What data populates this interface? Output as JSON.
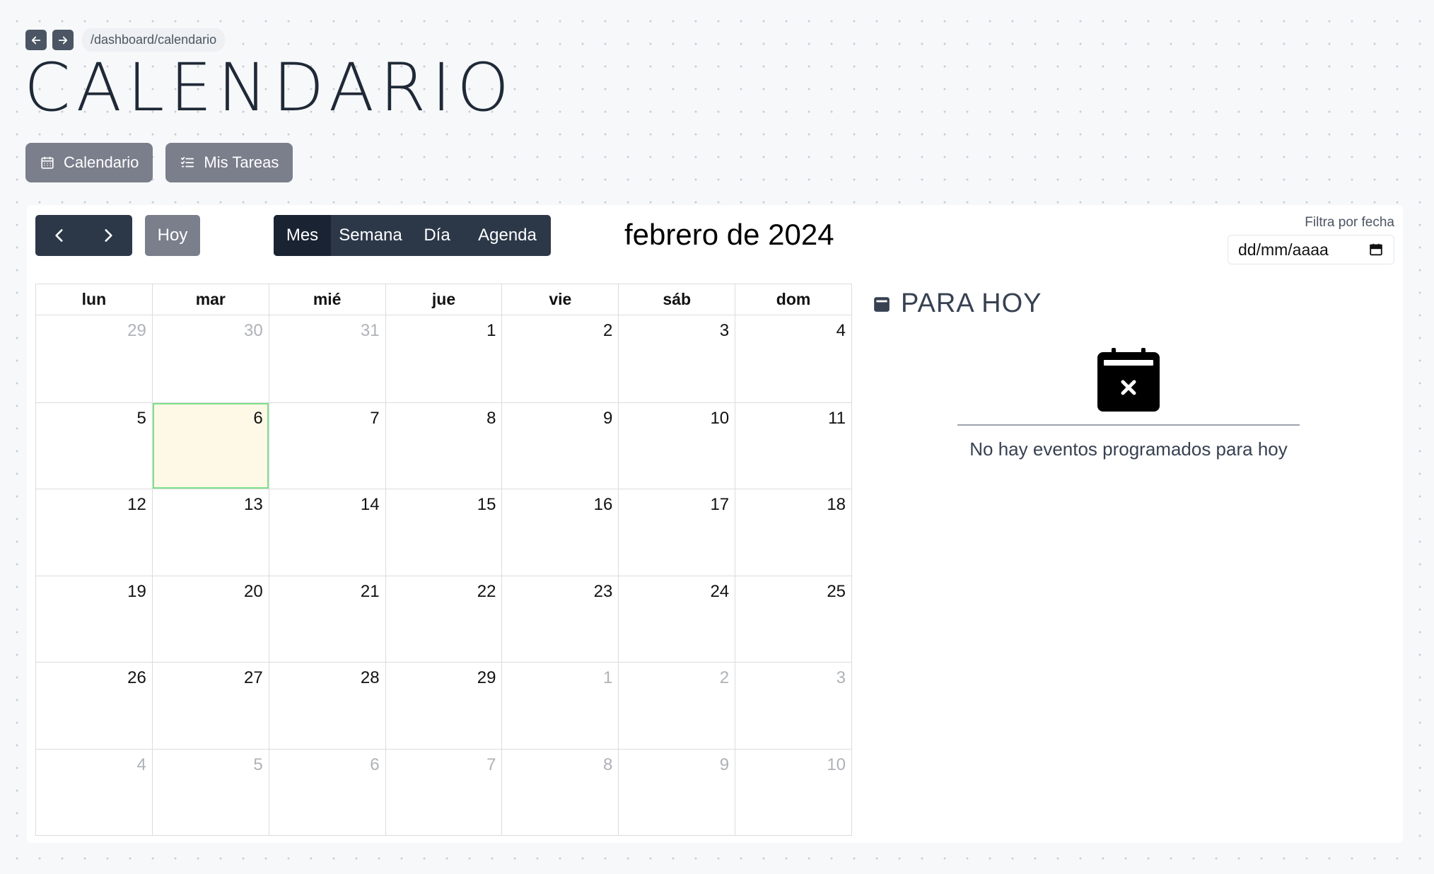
{
  "breadcrumb": "/dashboard/calendario",
  "page_title": "CALENDARIO",
  "page_tabs": [
    "Calendario",
    "Mis Tareas"
  ],
  "toolbar": {
    "today_label": "Hoy",
    "views": [
      "Mes",
      "Semana",
      "Día",
      "Agenda"
    ],
    "active_view": "Mes",
    "month_label": "febrero de 2024"
  },
  "filter": {
    "label": "Filtra por fecha",
    "placeholder": "dd/mm/aaaa"
  },
  "weekdays": [
    "lun",
    "mar",
    "mié",
    "jue",
    "vie",
    "sáb",
    "dom"
  ],
  "weeks": [
    [
      {
        "d": "29",
        "off": true
      },
      {
        "d": "30",
        "off": true
      },
      {
        "d": "31",
        "off": true
      },
      {
        "d": "1"
      },
      {
        "d": "2"
      },
      {
        "d": "3"
      },
      {
        "d": "4"
      }
    ],
    [
      {
        "d": "5"
      },
      {
        "d": "6",
        "today": true
      },
      {
        "d": "7"
      },
      {
        "d": "8"
      },
      {
        "d": "9"
      },
      {
        "d": "10"
      },
      {
        "d": "11"
      }
    ],
    [
      {
        "d": "12"
      },
      {
        "d": "13"
      },
      {
        "d": "14"
      },
      {
        "d": "15"
      },
      {
        "d": "16"
      },
      {
        "d": "17"
      },
      {
        "d": "18"
      }
    ],
    [
      {
        "d": "19"
      },
      {
        "d": "20"
      },
      {
        "d": "21"
      },
      {
        "d": "22"
      },
      {
        "d": "23"
      },
      {
        "d": "24"
      },
      {
        "d": "25"
      }
    ],
    [
      {
        "d": "26"
      },
      {
        "d": "27"
      },
      {
        "d": "28"
      },
      {
        "d": "29"
      },
      {
        "d": "1",
        "off": true
      },
      {
        "d": "2",
        "off": true
      },
      {
        "d": "3",
        "off": true
      }
    ],
    [
      {
        "d": "4",
        "off": true
      },
      {
        "d": "5",
        "off": true
      },
      {
        "d": "6",
        "off": true
      },
      {
        "d": "7",
        "off": true
      },
      {
        "d": "8",
        "off": true
      },
      {
        "d": "9",
        "off": true
      },
      {
        "d": "10",
        "off": true
      }
    ]
  ],
  "para_hoy": {
    "title": "PARA HOY",
    "empty_message": "No hay eventos programados para hoy"
  },
  "colors": {
    "dark_button": "#2c3848",
    "gray_button": "#7b7f8c",
    "today_bg": "#fef9e7",
    "today_border": "#7ee08a"
  }
}
